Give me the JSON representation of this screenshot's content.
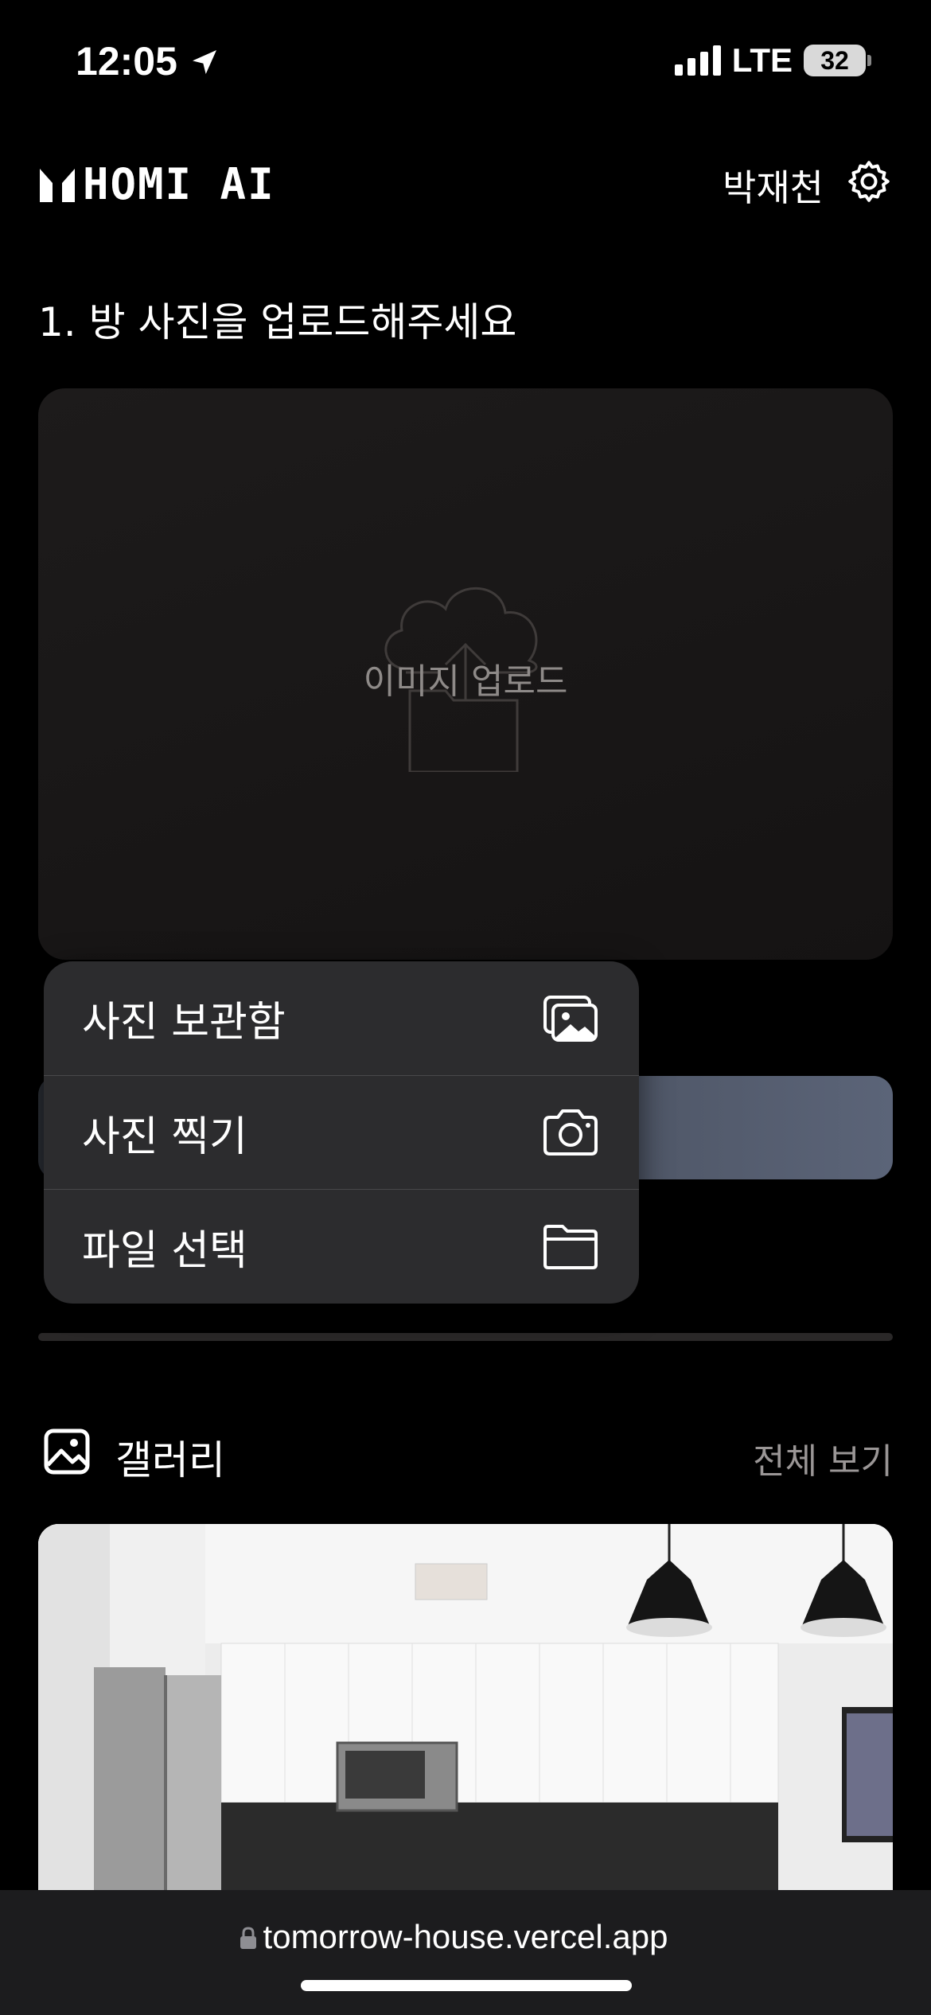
{
  "status_bar": {
    "time": "12:05",
    "network": "LTE",
    "battery": "32"
  },
  "header": {
    "logo_text": "HOMI AI",
    "user_name": "박재천"
  },
  "step": {
    "title": "1. 방 사진을 업로드해주세요"
  },
  "upload": {
    "label": "이미지 업로드"
  },
  "menu": {
    "items": [
      {
        "label": "사진 보관함",
        "icon": "photo-library-icon"
      },
      {
        "label": "사진 찍기",
        "icon": "camera-icon"
      },
      {
        "label": "파일 선택",
        "icon": "folder-icon"
      }
    ]
  },
  "gallery": {
    "title": "갤러리",
    "view_all": "전체 보기"
  },
  "browser": {
    "url": "tomorrow-house.vercel.app"
  },
  "colors": {
    "background": "#000000",
    "menu_bg": "#2c2c2e",
    "button_accent": "#5b6478"
  }
}
